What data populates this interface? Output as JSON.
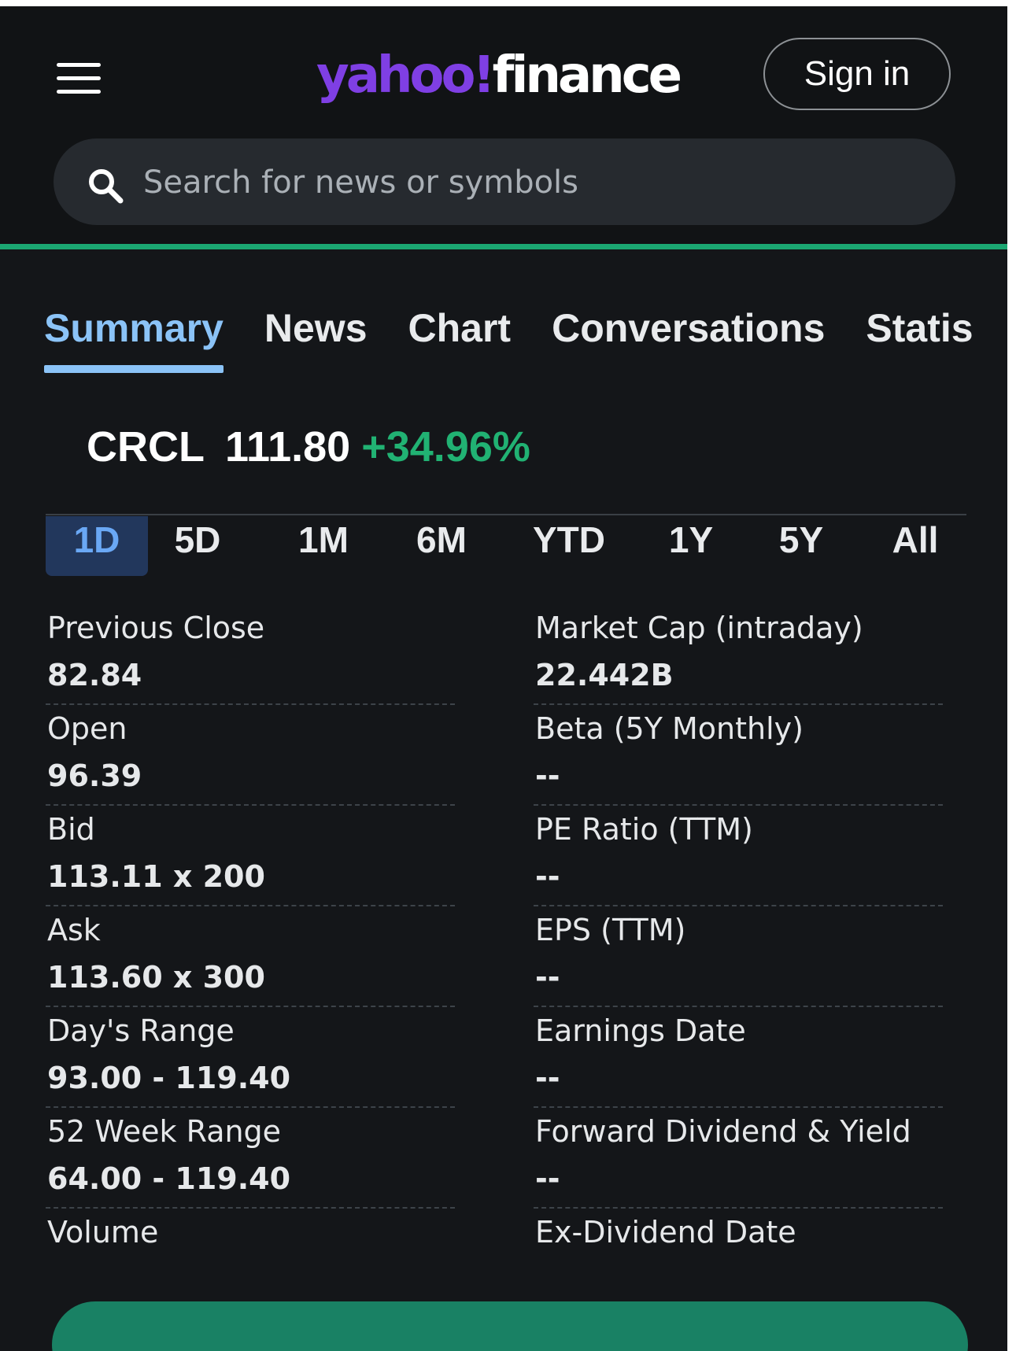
{
  "header": {
    "logo_brand": "yahoo!",
    "logo_product": "finance",
    "sign_in_label": "Sign in"
  },
  "search": {
    "placeholder": "Search for news or symbols"
  },
  "tabs": [
    {
      "label": "Summary",
      "active": true
    },
    {
      "label": "News"
    },
    {
      "label": "Chart"
    },
    {
      "label": "Conversations"
    },
    {
      "label": "Statis"
    }
  ],
  "quote": {
    "symbol": "CRCL",
    "price": "111.80",
    "change_pct": "+34.96%"
  },
  "ranges": [
    {
      "label": "1D",
      "active": true
    },
    {
      "label": "5D"
    },
    {
      "label": "1M"
    },
    {
      "label": "6M"
    },
    {
      "label": "YTD"
    },
    {
      "label": "1Y"
    },
    {
      "label": "5Y"
    },
    {
      "label": "All"
    }
  ],
  "stats_left": [
    {
      "label": "Previous Close",
      "value": "82.84"
    },
    {
      "label": "Open",
      "value": "96.39"
    },
    {
      "label": "Bid",
      "value": "113.11 x 200"
    },
    {
      "label": "Ask",
      "value": "113.60 x 300"
    },
    {
      "label": "Day's Range",
      "value": "93.00 - 119.40"
    },
    {
      "label": "52 Week Range",
      "value": "64.00 - 119.40"
    },
    {
      "label": "Volume",
      "value": ""
    }
  ],
  "stats_right": [
    {
      "label": "Market Cap (intraday)",
      "value": "22.442B"
    },
    {
      "label": "Beta (5Y Monthly)",
      "value": "--"
    },
    {
      "label": "PE Ratio (TTM)",
      "value": "--"
    },
    {
      "label": "EPS (TTM)",
      "value": "--"
    },
    {
      "label": "Earnings Date",
      "value": "--"
    },
    {
      "label": "Forward Dividend & Yield",
      "value": "--"
    },
    {
      "label": "Ex-Dividend Date",
      "value": ""
    }
  ],
  "colors": {
    "accent_purple": "#7f3fe4",
    "positive_green": "#21b273",
    "active_tab_blue": "#8bc3f7",
    "cta_green": "#198164"
  },
  "icons": {
    "menu": "hamburger-menu-icon",
    "search": "search-icon"
  }
}
